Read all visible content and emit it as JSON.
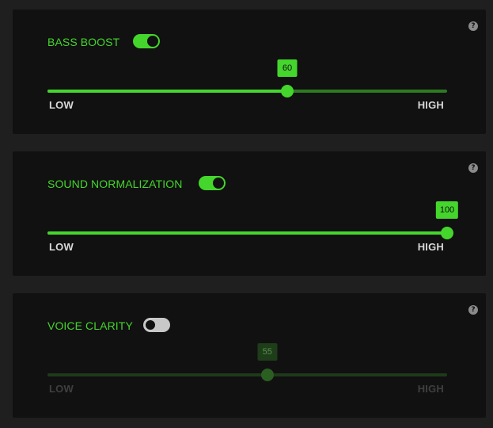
{
  "help_glyph": "?",
  "accent_color": "#44d62c",
  "panels": [
    {
      "title": "BASS BOOST",
      "enabled": true,
      "value": 60,
      "value_label": "60",
      "min_label": "LOW",
      "max_label": "HIGH",
      "help_icon": "question-circle-icon"
    },
    {
      "title": "SOUND NORMALIZATION",
      "enabled": true,
      "value": 100,
      "value_label": "100",
      "min_label": "LOW",
      "max_label": "HIGH",
      "help_icon": "question-circle-icon"
    },
    {
      "title": "VOICE CLARITY",
      "enabled": false,
      "value": 55,
      "value_label": "55",
      "min_label": "LOW",
      "max_label": "HIGH",
      "help_icon": "question-circle-icon"
    }
  ]
}
